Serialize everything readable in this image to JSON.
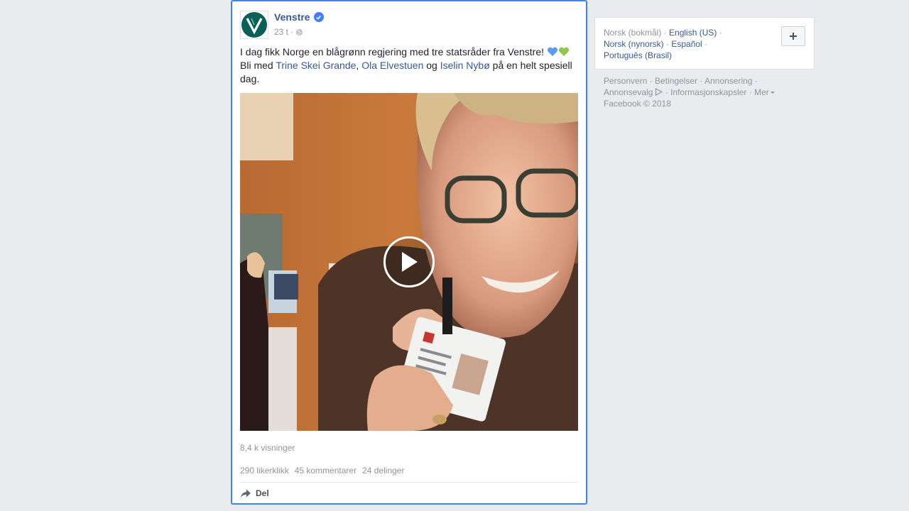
{
  "post": {
    "page_name": "Venstre",
    "time": "23 t",
    "separator": "·",
    "text_part1": "I dag fikk Norge en blågrønn regjering med tre statsråder fra Venstre! ",
    "text_part2": "Bli med ",
    "mention1": "Trine Skei Grande",
    "comma": ", ",
    "mention2": "Ola Elvestuen",
    "text_og": " og ",
    "mention3": "Iselin Nybø",
    "text_end": " på en helt spesiell dag.",
    "views": "8,4 k visninger",
    "likes": "290 likerklikk",
    "comments": "45 kommentarer",
    "shares": "24 delinger",
    "share_label": "Del"
  },
  "languages": {
    "current": "Norsk (bokmål)",
    "options": [
      "English (US)",
      "Norsk (nynorsk)",
      "Español",
      "Português (Brasil)"
    ]
  },
  "footer": {
    "links": [
      "Personvern",
      "Betingelser",
      "Annonsering",
      "Annonsevalg",
      "Informasjonskapsler",
      "Mer"
    ],
    "copyright": "Facebook © 2018"
  },
  "icons": {
    "verified": "verified-badge-icon",
    "audience": "globe-icon",
    "play": "play-icon",
    "share": "share-arrow-icon",
    "add": "plus-icon",
    "adchoices": "adchoices-icon",
    "blue_heart": "blue-heart-icon",
    "green_heart": "green-heart-icon"
  },
  "colors": {
    "accent": "#4080ff",
    "link": "#385898",
    "muted": "#90949c",
    "background": "#e9ebee"
  }
}
